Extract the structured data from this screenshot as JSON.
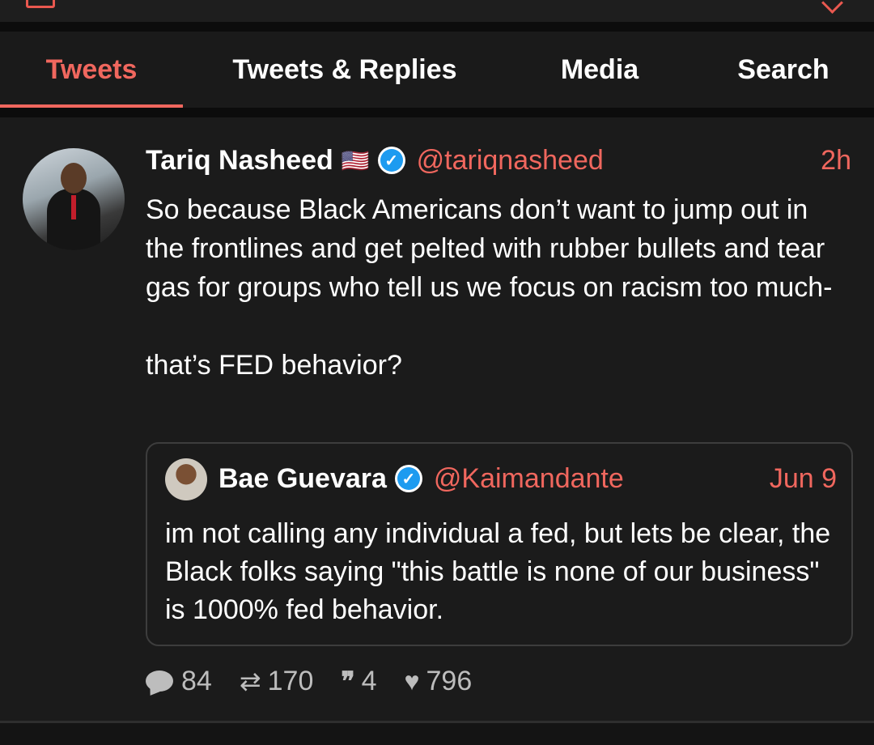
{
  "tabs": [
    "Tweets",
    "Tweets & Replies",
    "Media",
    "Search"
  ],
  "active_tab": "Tweets",
  "accent_color": "#f0675e",
  "tweet": {
    "name": "Tariq Nasheed",
    "flag": "🇺🇸",
    "handle": "@tariqnasheed",
    "time": "2h",
    "text": "So because Black Americans don’t want to jump out in the frontlines and get pelted with rubber bullets and tear gas for groups who tell us we focus on racism too much-\n\nthat’s FED behavior?",
    "quote": {
      "name": "Bae Guevara",
      "handle": "@Kaimandante",
      "time": "Jun 9",
      "text": "im not calling any individual a fed, but lets be clear, the Black folks saying \"this battle is none of our business\" is 1000% fed behavior."
    },
    "stats": {
      "replies": "84",
      "retweets": "170",
      "quotes": "4",
      "likes": "796"
    }
  }
}
